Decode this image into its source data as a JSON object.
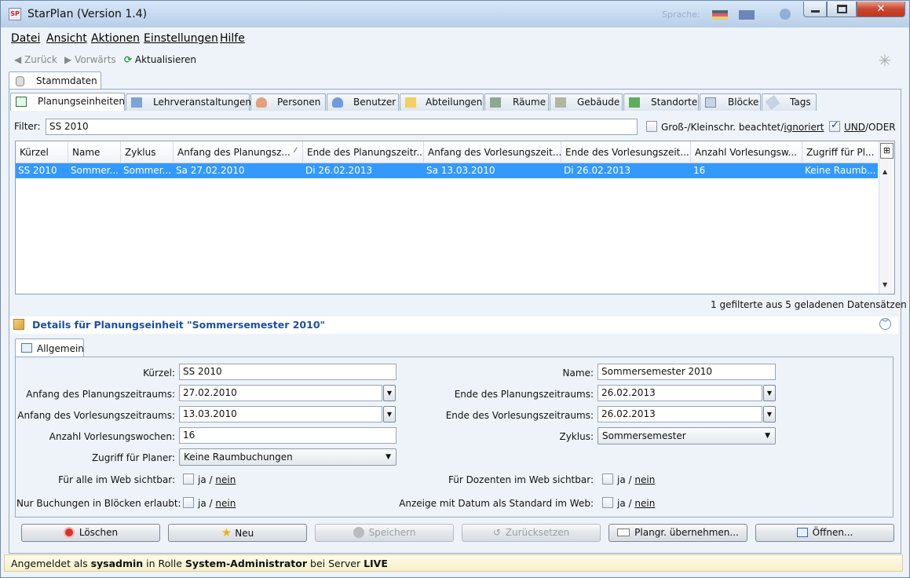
{
  "window": {
    "title": "StarPlan (Version 1.4)",
    "language_label": "Sprache:",
    "app_icon": "SP"
  },
  "menu": [
    "Datei",
    "Ansicht",
    "Aktionen",
    "Einstellungen",
    "Hilfe"
  ],
  "toolbar": {
    "back": "Zurück",
    "forward": "Vorwärts",
    "refresh": "Aktualisieren"
  },
  "outer_tab": "Stammdaten",
  "tabs": [
    "Planungseinheiten",
    "Lehrveranstaltungen",
    "Personen",
    "Benutzer",
    "Abteilungen",
    "Räume",
    "Gebäude",
    "Standorte",
    "Blöcke",
    "Tags"
  ],
  "filter": {
    "label": "Filter:",
    "value": "SS 2010",
    "case_label_a": "Groß-/Kleinschr. beachtet/",
    "case_label_b": "ignoriert",
    "und_label": "UND",
    "oder_label": "/ODER"
  },
  "table": {
    "columns": [
      "Kürzel",
      "Name",
      "Zyklus",
      "Anfang des Planungsz...",
      "Ende des Planungszeitr...",
      "Anfang des Vorlesungszeit...",
      "Ende des Vorlesungszeit...",
      "Anzahl Vorlesungsw...",
      "Zugriff für Pl..."
    ],
    "rows": [
      [
        "SS 2010",
        "Sommer...",
        "Sommer...",
        "Sa 27.02.2010",
        "Di 26.02.2013",
        "Sa 13.03.2010",
        "Di 26.02.2013",
        "16",
        "Keine Raumb..."
      ]
    ],
    "sort_indicator": "⁄"
  },
  "record_count": "1 gefilterte aus 5 geladenen Datensätzen",
  "details": {
    "title": "Details für Planungseinheit \"Sommersemester 2010\"",
    "tab": "Allgemein",
    "fields": {
      "kuerzel_label": "Kürzel:",
      "kuerzel_value": "SS 2010",
      "name_label": "Name:",
      "name_value": "Sommersemester 2010",
      "anfang_plan_label": "Anfang des Planungszeitraums:",
      "anfang_plan_value": "27.02.2010",
      "ende_plan_label": "Ende des Planungszeitraums:",
      "ende_plan_value": "26.02.2013",
      "anfang_vorl_label": "Anfang des Vorlesungszeitraums:",
      "anfang_vorl_value": "13.03.2010",
      "ende_vorl_label": "Ende des Vorlesungszeitraums:",
      "ende_vorl_value": "26.02.2013",
      "wochen_label": "Anzahl Vorlesungswochen:",
      "wochen_value": "16",
      "zyklus_label": "Zyklus:",
      "zyklus_value": "Sommersemester",
      "zugriff_label": "Zugriff für Planer:",
      "zugriff_value": "Keine Raumbuchungen",
      "web_alle_label": "Für alle im Web sichtbar:",
      "web_dozenten_label": "Für Dozenten im Web sichtbar:",
      "bloecke_label": "Nur Buchungen in Blöcken erlaubt:",
      "datum_label": "Anzeige mit Datum als Standard im Web:",
      "ja": "ja",
      "slash": "/",
      "nein": "nein"
    }
  },
  "buttons": {
    "delete": "Löschen",
    "new": "Neu",
    "save": "Speichern",
    "reset": "Zurücksetzen",
    "apply": "Plangr. übernehmen...",
    "open": "Öffnen..."
  },
  "status": {
    "prefix": "Angemeldet als ",
    "user": "sysadmin",
    "mid": " in Rolle ",
    "role": "System-Administrator",
    "mid2": " bei Server ",
    "server": "LIVE"
  },
  "colors": {
    "selection": "#3399ff",
    "details_title": "#1e4fa3",
    "close_button": "#c9462f"
  }
}
